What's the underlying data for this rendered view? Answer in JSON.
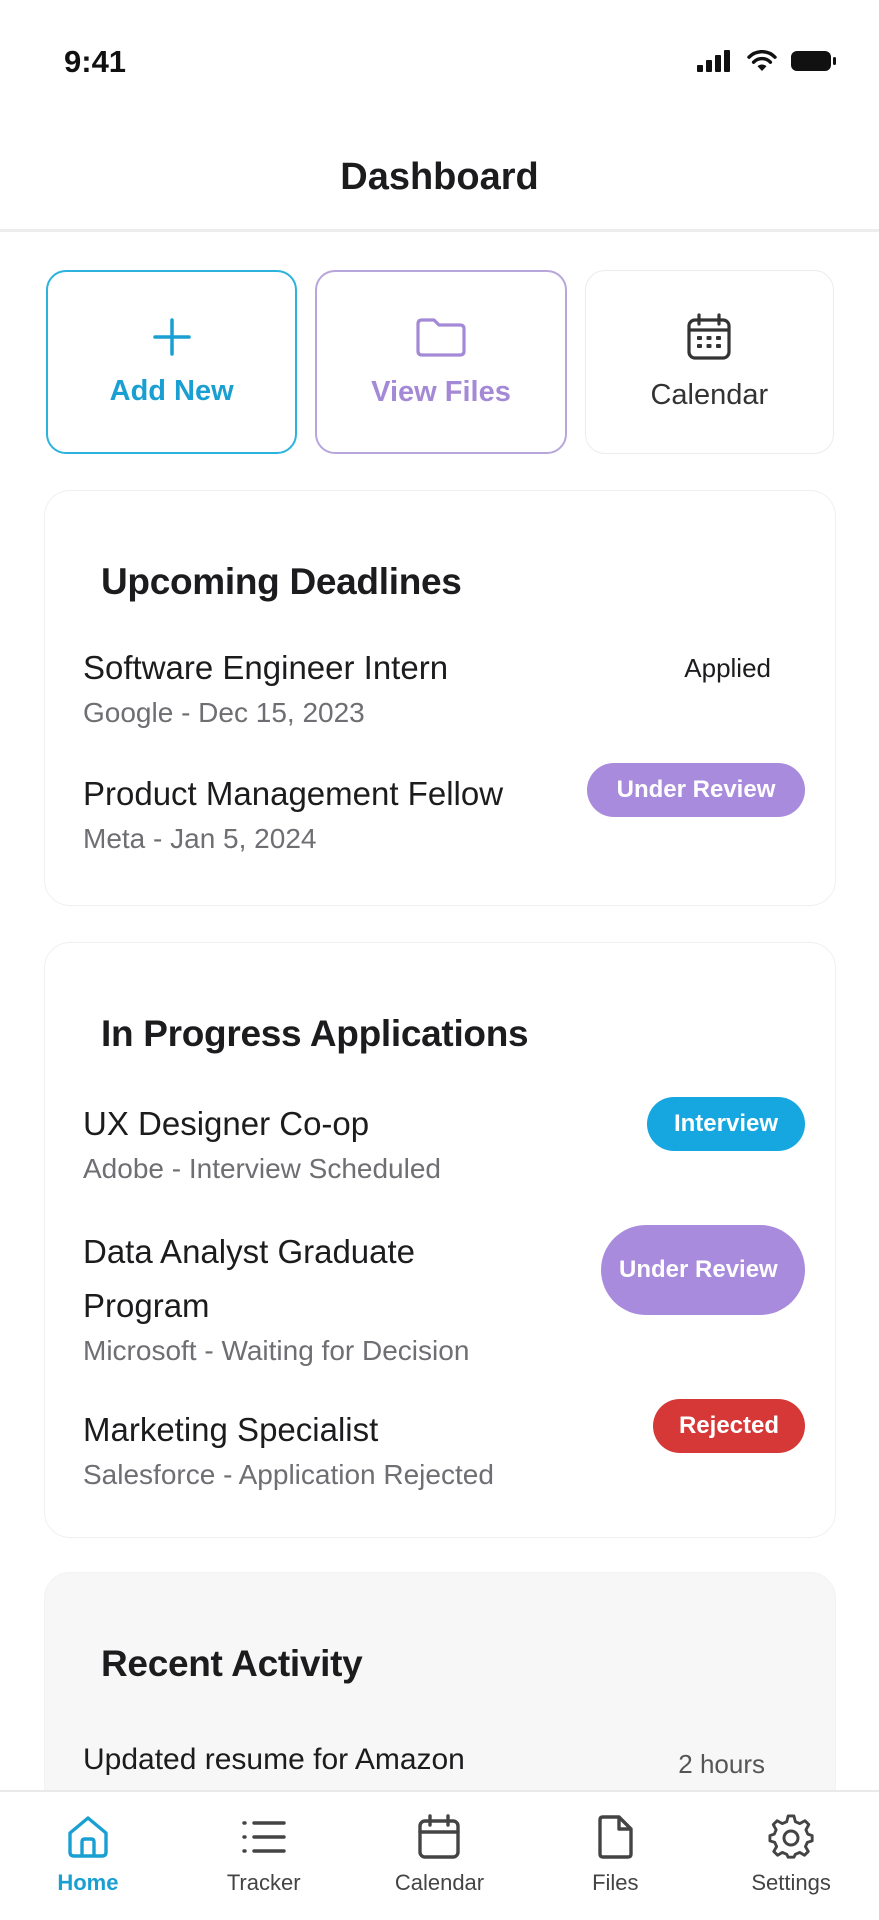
{
  "status_bar": {
    "time": "9:41"
  },
  "header": {
    "title": "Dashboard"
  },
  "quick_actions": [
    {
      "label": "Add New",
      "icon": "plus-icon",
      "color": "#1a9fd2"
    },
    {
      "label": "View Files",
      "icon": "folder-icon",
      "color": "#a48ad6"
    },
    {
      "label": "Calendar",
      "icon": "calendar-icon",
      "color": "#333333"
    }
  ],
  "deadlines": {
    "title": "Upcoming Deadlines",
    "items": [
      {
        "title": "Software Engineer Intern",
        "sub": "Google - Dec 15, 2023",
        "status": "Applied"
      },
      {
        "title": "Product Management Fellow",
        "sub": "Meta - Jan 5, 2024",
        "status": "Under Review"
      }
    ]
  },
  "in_progress": {
    "title": "In Progress Applications",
    "items": [
      {
        "title": "UX Designer Co-op",
        "sub": "Adobe - Interview Scheduled",
        "status": "Interview"
      },
      {
        "title": "Data Analyst Graduate Program",
        "sub": "Microsoft - Waiting for Decision",
        "status": "Under Review"
      },
      {
        "title": "Marketing Specialist",
        "sub": "Salesforce - Application Rejected",
        "status": "Rejected"
      }
    ]
  },
  "recent_activity": {
    "title": "Recent Activity",
    "items": [
      {
        "text": "Updated resume for Amazon",
        "time": "2 hours"
      }
    ]
  },
  "tabbar": [
    {
      "label": "Home",
      "icon": "home-icon",
      "active": true
    },
    {
      "label": "Tracker",
      "icon": "list-icon",
      "active": false
    },
    {
      "label": "Calendar",
      "icon": "calendar-icon",
      "active": false
    },
    {
      "label": "Files",
      "icon": "file-icon",
      "active": false
    },
    {
      "label": "Settings",
      "icon": "gear-icon",
      "active": false
    }
  ],
  "colors": {
    "accent": "#1a9fd2",
    "purple": "#a88bdc",
    "blue_badge": "#17a7e0",
    "red_badge": "#d63838"
  }
}
